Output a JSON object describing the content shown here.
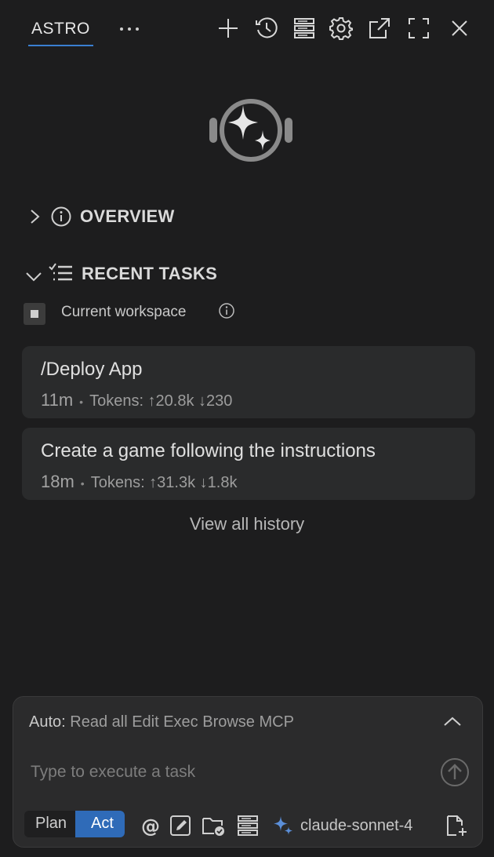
{
  "header": {
    "tab_title": "ASTRO",
    "icons": [
      "more-icon",
      "plus-icon",
      "history-icon",
      "server-icon",
      "gear-icon",
      "external-link-icon",
      "fullscreen-icon",
      "close-icon"
    ]
  },
  "overview": {
    "title": "OVERVIEW"
  },
  "recent_tasks": {
    "title": "RECENT TASKS",
    "filter_label": "Current workspace",
    "filter_checked": true,
    "tasks": [
      {
        "title": "/Deploy App",
        "time": "11m",
        "tokens": "Tokens: ↑20.8k ↓230"
      },
      {
        "title": "Create a game following the instructions",
        "time": "18m",
        "tokens": "Tokens: ↑31.3k ↓1.8k"
      }
    ],
    "view_all": "View all history"
  },
  "composer": {
    "auto_label": "Auto:",
    "auto_value": "Read all Edit Exec Browse MCP",
    "input_placeholder": "Type to execute a task",
    "input_value": "",
    "modes": [
      "Plan",
      "Act"
    ],
    "active_mode": "Act",
    "model": "claude-sonnet-4"
  },
  "colors": {
    "background": "#1d1d1e",
    "card": "#2a2b2c",
    "accent": "#3a7fd1",
    "active_mode": "#2f6bb8"
  }
}
